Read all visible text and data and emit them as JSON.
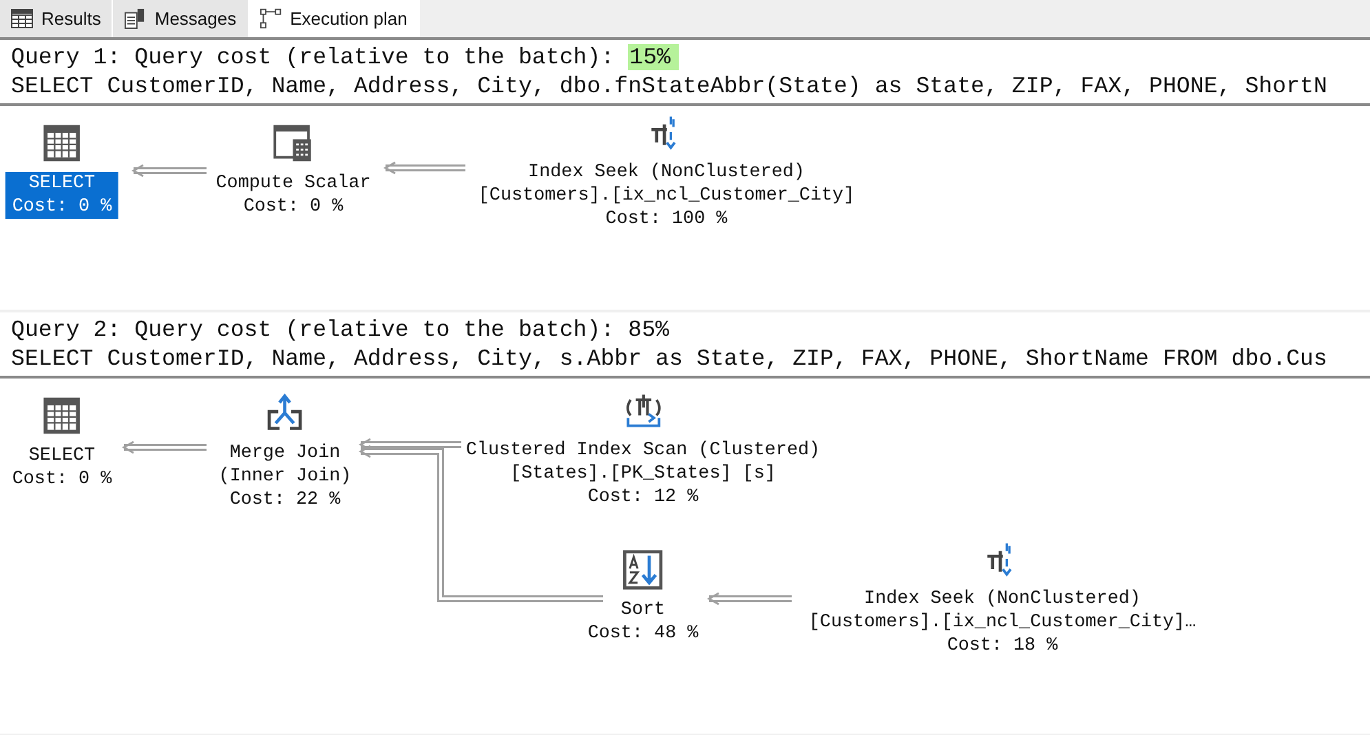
{
  "tabs": [
    {
      "label": "Results",
      "kind": "grid",
      "selected": false
    },
    {
      "label": "Messages",
      "kind": "messages",
      "selected": false
    },
    {
      "label": "Execution plan",
      "kind": "plan",
      "selected": true
    }
  ],
  "queries": [
    {
      "heading": "Query 1: Query cost (relative to the batch): ",
      "cost": "15%",
      "highlighted": true,
      "sql": "SELECT CustomerID, Name, Address, City, dbo.fnStateAbbr(State) as State, ZIP, FAX, PHONE, ShortN",
      "nodes": [
        {
          "kind": "select",
          "lines": [
            "SELECT"
          ],
          "cost": "Cost: 0 %",
          "selected": true
        },
        {
          "kind": "compute",
          "lines": [
            "Compute Scalar"
          ],
          "cost": "Cost: 0 %",
          "selected": false
        },
        {
          "kind": "seek",
          "lines": [
            "Index Seek (NonClustered)",
            "[Customers].[ix_ncl_Customer_City]"
          ],
          "cost": "Cost: 100 %",
          "selected": false
        }
      ]
    },
    {
      "heading": "Query 2: Query cost (relative to the batch): ",
      "cost": "85%",
      "highlighted": false,
      "sql": "SELECT CustomerID, Name, Address, City, s.Abbr as State, ZIP, FAX, PHONE, ShortName FROM dbo.Cus",
      "nodes": [
        {
          "kind": "select",
          "lines": [
            "SELECT"
          ],
          "cost": "Cost: 0 %",
          "selected": false
        },
        {
          "kind": "merge",
          "lines": [
            "Merge Join",
            "(Inner Join)"
          ],
          "cost": "Cost: 22 %",
          "selected": false
        },
        {
          "kind": "scan",
          "lines": [
            "Clustered Index Scan (Clustered)",
            "[States].[PK_States] [s]"
          ],
          "cost": "Cost: 12 %",
          "selected": false
        },
        {
          "kind": "sort",
          "lines": [
            "Sort"
          ],
          "cost": "Cost: 48 %",
          "selected": false
        },
        {
          "kind": "seek",
          "lines": [
            "Index Seek (NonClustered)",
            "[Customers].[ix_ncl_Customer_City]…"
          ],
          "cost": "Cost: 18 %",
          "selected": false
        }
      ]
    }
  ]
}
